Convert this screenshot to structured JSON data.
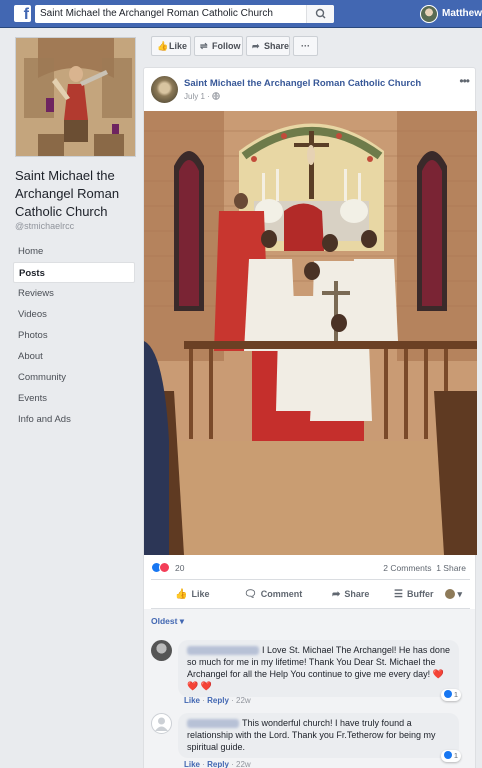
{
  "topbar": {
    "logo": "f",
    "search_value": "Saint Michael the Archangel Roman Catholic Church",
    "user_name": "Matthew"
  },
  "page": {
    "name": "Saint Michael the Archangel Roman Catholic Church",
    "handle": "@stmichaelrcc"
  },
  "nav": [
    {
      "label": "Home"
    },
    {
      "label": "Posts",
      "active": true
    },
    {
      "label": "Reviews"
    },
    {
      "label": "Videos"
    },
    {
      "label": "Photos"
    },
    {
      "label": "About"
    },
    {
      "label": "Community"
    },
    {
      "label": "Events"
    },
    {
      "label": "Info and Ads"
    }
  ],
  "action_bar": {
    "like": "Like",
    "follow": "Follow",
    "share": "Share",
    "more": "···"
  },
  "post": {
    "author": "Saint Michael the Archangel Roman Catholic Church",
    "date": "July 1 ·",
    "more": "•••",
    "reaction_count": "20",
    "comments": "2 Comments",
    "shares": "1 Share",
    "actions": {
      "like": "Like",
      "comment": "Comment",
      "share": "Share",
      "buffer": "Buffer"
    }
  },
  "comments_sort": "Oldest ▾",
  "comments": [
    {
      "text": "I Love St. Michael The Archangel! He has done so much for me in my lifetime! Thank You Dear St. Michael the Archangel for all the Help You continue to give me every day! ❤️❤️ ❤️",
      "like": "Like",
      "reply": "Reply",
      "time": "22w",
      "reactions": "1"
    },
    {
      "text": "This wonderful church! I have truly found a relationship with the Lord. Thank you Fr.Tetherow for being my spiritual guide.",
      "like": "Like",
      "reply": "Reply",
      "time": "22w",
      "reactions": "1"
    }
  ],
  "colors": {
    "brand_blue": "#4267b2",
    "link_blue": "#385898",
    "page_bg": "#e9ebee",
    "love_red": "#f33e58"
  }
}
